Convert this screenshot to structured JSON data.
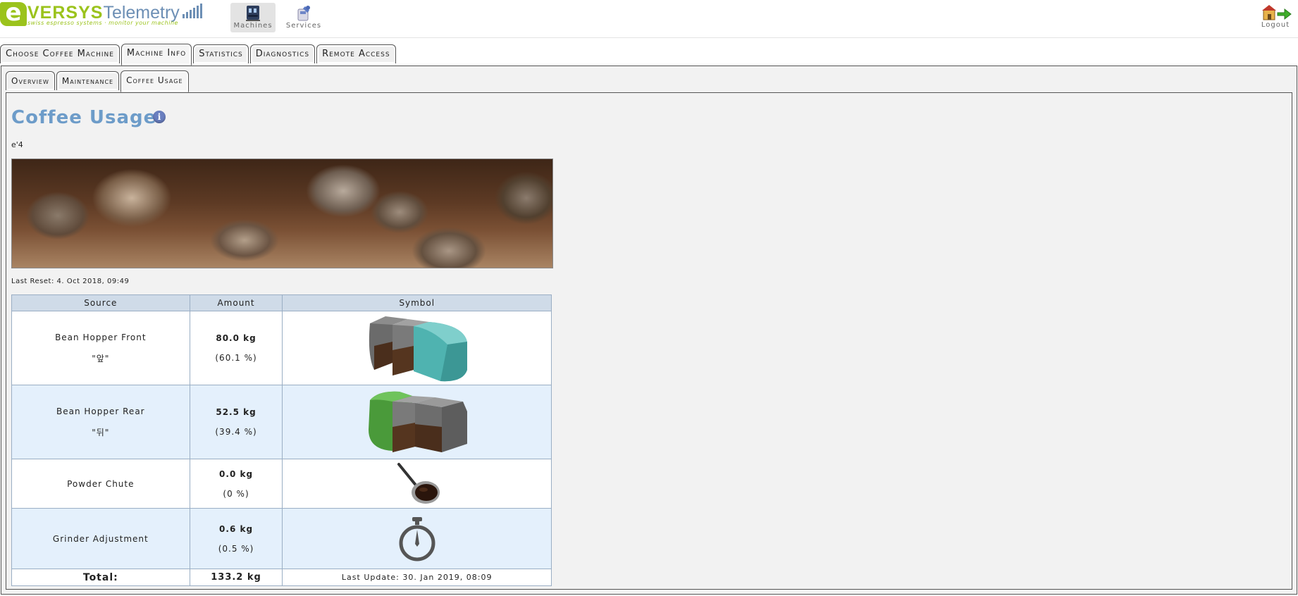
{
  "header": {
    "logo": {
      "e": "e",
      "versys": "VERSYS",
      "telemetry": "Telemetry",
      "tagline": "swiss espresso systems · monitor your machine"
    },
    "nav": [
      {
        "label": "Machines",
        "icon": "machines-icon"
      },
      {
        "label": "Services",
        "icon": "services-icon"
      }
    ],
    "logout": {
      "label": "Logout",
      "icon": "logout-icon"
    }
  },
  "tabs": {
    "main": [
      "Choose Coffee Machine",
      "Machine Info",
      "Statistics",
      "Diagnostics",
      "Remote Access"
    ],
    "main_active": "Machine Info",
    "sub": [
      "Overview",
      "Maintenance",
      "Coffee Usage"
    ],
    "sub_active": "Coffee Usage"
  },
  "content": {
    "title": "Coffee Usage",
    "info_icon": "i",
    "machine_name": "e'4",
    "last_reset": "Last Reset: 4. Oct 2018, 09:49",
    "table": {
      "headers": [
        "Source",
        "Amount",
        "Symbol"
      ],
      "rows": [
        {
          "source": "Bean Hopper Front",
          "source_sub": "\"앞\"",
          "amount": "80.0 kg",
          "percent": "(60.1 %)",
          "symbol": "bean-hopper-front-icon"
        },
        {
          "source": "Bean Hopper Rear",
          "source_sub": "\"뒤\"",
          "amount": "52.5 kg",
          "percent": "(39.4 %)",
          "symbol": "bean-hopper-rear-icon"
        },
        {
          "source": "Powder Chute",
          "source_sub": "",
          "amount": "0.0 kg",
          "percent": "(0 %)",
          "symbol": "powder-scoop-icon"
        },
        {
          "source": "Grinder Adjustment",
          "source_sub": "",
          "amount": "0.6 kg",
          "percent": "(0.5 %)",
          "symbol": "stopwatch-icon"
        }
      ],
      "total_label": "Total:",
      "total_amount": "133.2 kg",
      "last_update": "Last Update: 30. Jan 2019, 08:09"
    }
  },
  "colors": {
    "brand_green": "#9bc31c",
    "brand_blue": "#6d8fb5",
    "title_blue": "#6d9cc9",
    "header_row": "#cfdbe8",
    "alt_row": "#e4f0fc",
    "hopper_teal": "#4fb3b0",
    "hopper_green": "#4a9a3a"
  }
}
